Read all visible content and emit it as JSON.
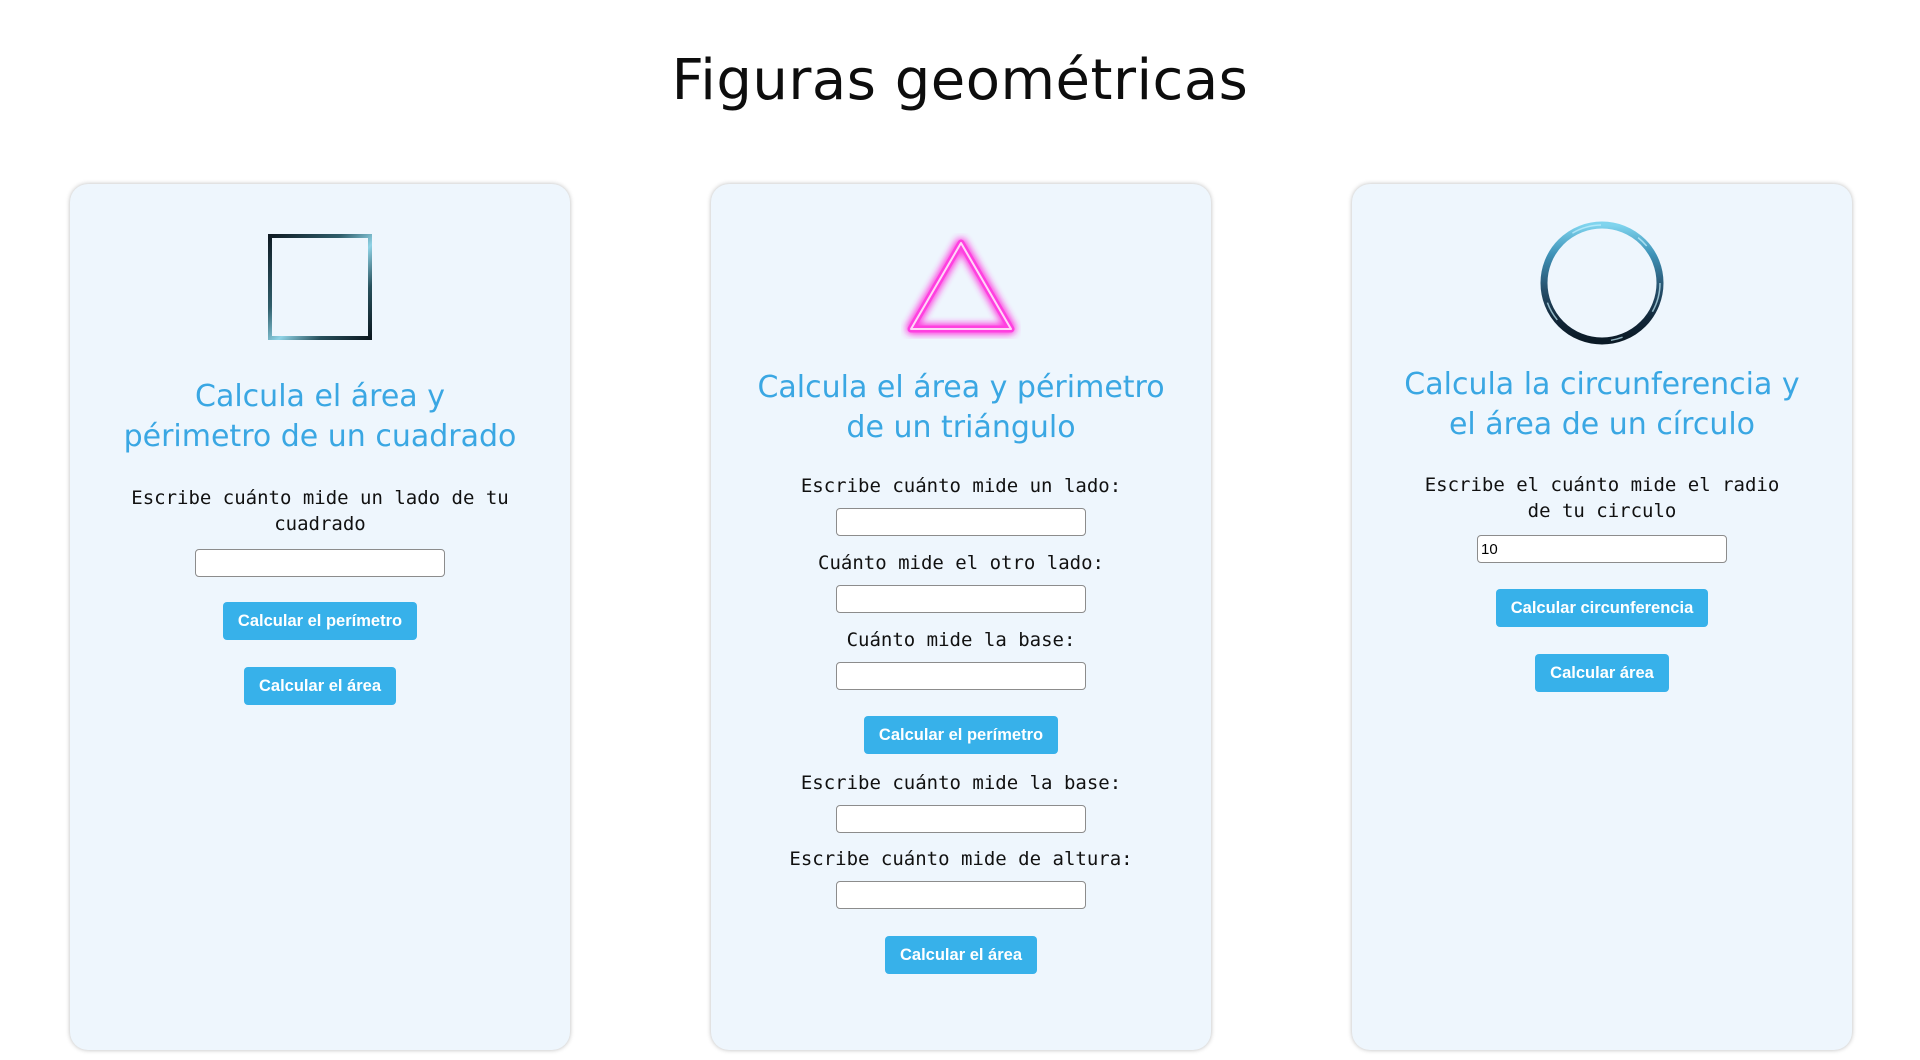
{
  "page": {
    "title": "Figuras geométricas"
  },
  "square": {
    "icon": "square-outline-icon",
    "heading": "Calcula el área y périmetro de un cuadrado",
    "side_label": "Escribe cuánto mide un lado de tu cuadrado",
    "side_value": "",
    "perimeter_button": "Calcular el perímetro",
    "area_button": "Calcular el área"
  },
  "triangle": {
    "icon": "neon-triangle-icon",
    "heading": "Calcula el área y périmetro de un triángulo",
    "side1_label": "Escribe cuánto mide un lado:",
    "side1_value": "",
    "side2_label": "Cuánto mide el otro lado:",
    "side2_value": "",
    "base_label": "Cuánto mide la base:",
    "base_value": "",
    "perimeter_button": "Calcular el perímetro",
    "area_base_label": "Escribe cuánto mide la base:",
    "area_base_value": "",
    "height_label": "Escribe cuánto mide de altura:",
    "height_value": "",
    "area_button": "Calcular el área"
  },
  "circle": {
    "icon": "circle-ring-icon",
    "heading": "Calcula la circunferencia y el área de un círculo",
    "radius_label": "Escribe el cuánto mide el radio de tu circulo",
    "radius_value": "10",
    "circumference_button": "Calcular circunferencia",
    "area_button": "Calcular área"
  },
  "colors": {
    "accent": "#37b1ea",
    "heading": "#3aa7e3",
    "card_bg": "#eef6fd",
    "neon_pink": "#ff4fe3"
  }
}
